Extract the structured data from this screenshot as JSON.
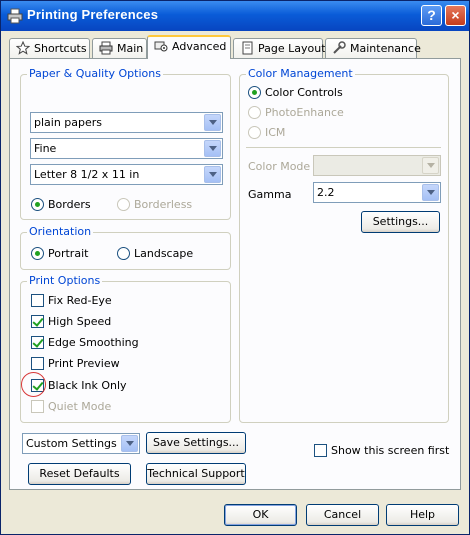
{
  "window": {
    "title": "Printing Preferences",
    "help_label": "?",
    "close_label": "×"
  },
  "tabs": [
    {
      "label": "Shortcuts",
      "icon": "star-icon"
    },
    {
      "label": "Main",
      "icon": "printer-icon"
    },
    {
      "label": "Advanced",
      "icon": "advanced-icon",
      "active": true
    },
    {
      "label": "Page Layout",
      "icon": "page-layout-icon"
    },
    {
      "label": "Maintenance",
      "icon": "wrench-icon"
    }
  ],
  "paper_quality": {
    "title": "Paper & Quality Options",
    "media_type": "plain papers",
    "quality": "Fine",
    "paper_size": "Letter 8 1/2 x 11 in",
    "borders_label": "Borders",
    "borderless_label": "Borderless",
    "selected": "Borders"
  },
  "orientation": {
    "title": "Orientation",
    "portrait_label": "Portrait",
    "landscape_label": "Landscape",
    "selected": "Portrait"
  },
  "print_options": {
    "title": "Print Options",
    "items": [
      {
        "label": "Fix Red-Eye",
        "checked": false,
        "enabled": true
      },
      {
        "label": "High Speed",
        "checked": true,
        "enabled": true
      },
      {
        "label": "Edge Smoothing",
        "checked": true,
        "enabled": true
      },
      {
        "label": "Print Preview",
        "checked": false,
        "enabled": true
      },
      {
        "label": "Black Ink Only",
        "checked": true,
        "enabled": true
      },
      {
        "label": "Quiet Mode",
        "checked": false,
        "enabled": false
      }
    ]
  },
  "color_management": {
    "title": "Color Management",
    "color_controls_label": "Color Controls",
    "photoenhance_label": "PhotoEnhance",
    "icm_label": "ICM",
    "selected": "Color Controls",
    "color_mode_label": "Color Mode",
    "color_mode_value": "",
    "gamma_label": "Gamma",
    "gamma_value": "2.2",
    "settings_button": "Settings..."
  },
  "bottom": {
    "custom_settings_value": "Custom Settings",
    "save_settings_button": "Save Settings...",
    "reset_defaults_button": "Reset Defaults",
    "technical_support_button": "Technical Support",
    "show_screen_first_label": "Show this screen first",
    "show_screen_first_checked": false
  },
  "footer": {
    "ok_label": "OK",
    "cancel_label": "Cancel",
    "help_label": "Help"
  },
  "colors": {
    "titlebar": "#0a5cd8",
    "group_title": "#0046d5",
    "check_green": "#21a121",
    "annotation_red": "#d83838"
  }
}
